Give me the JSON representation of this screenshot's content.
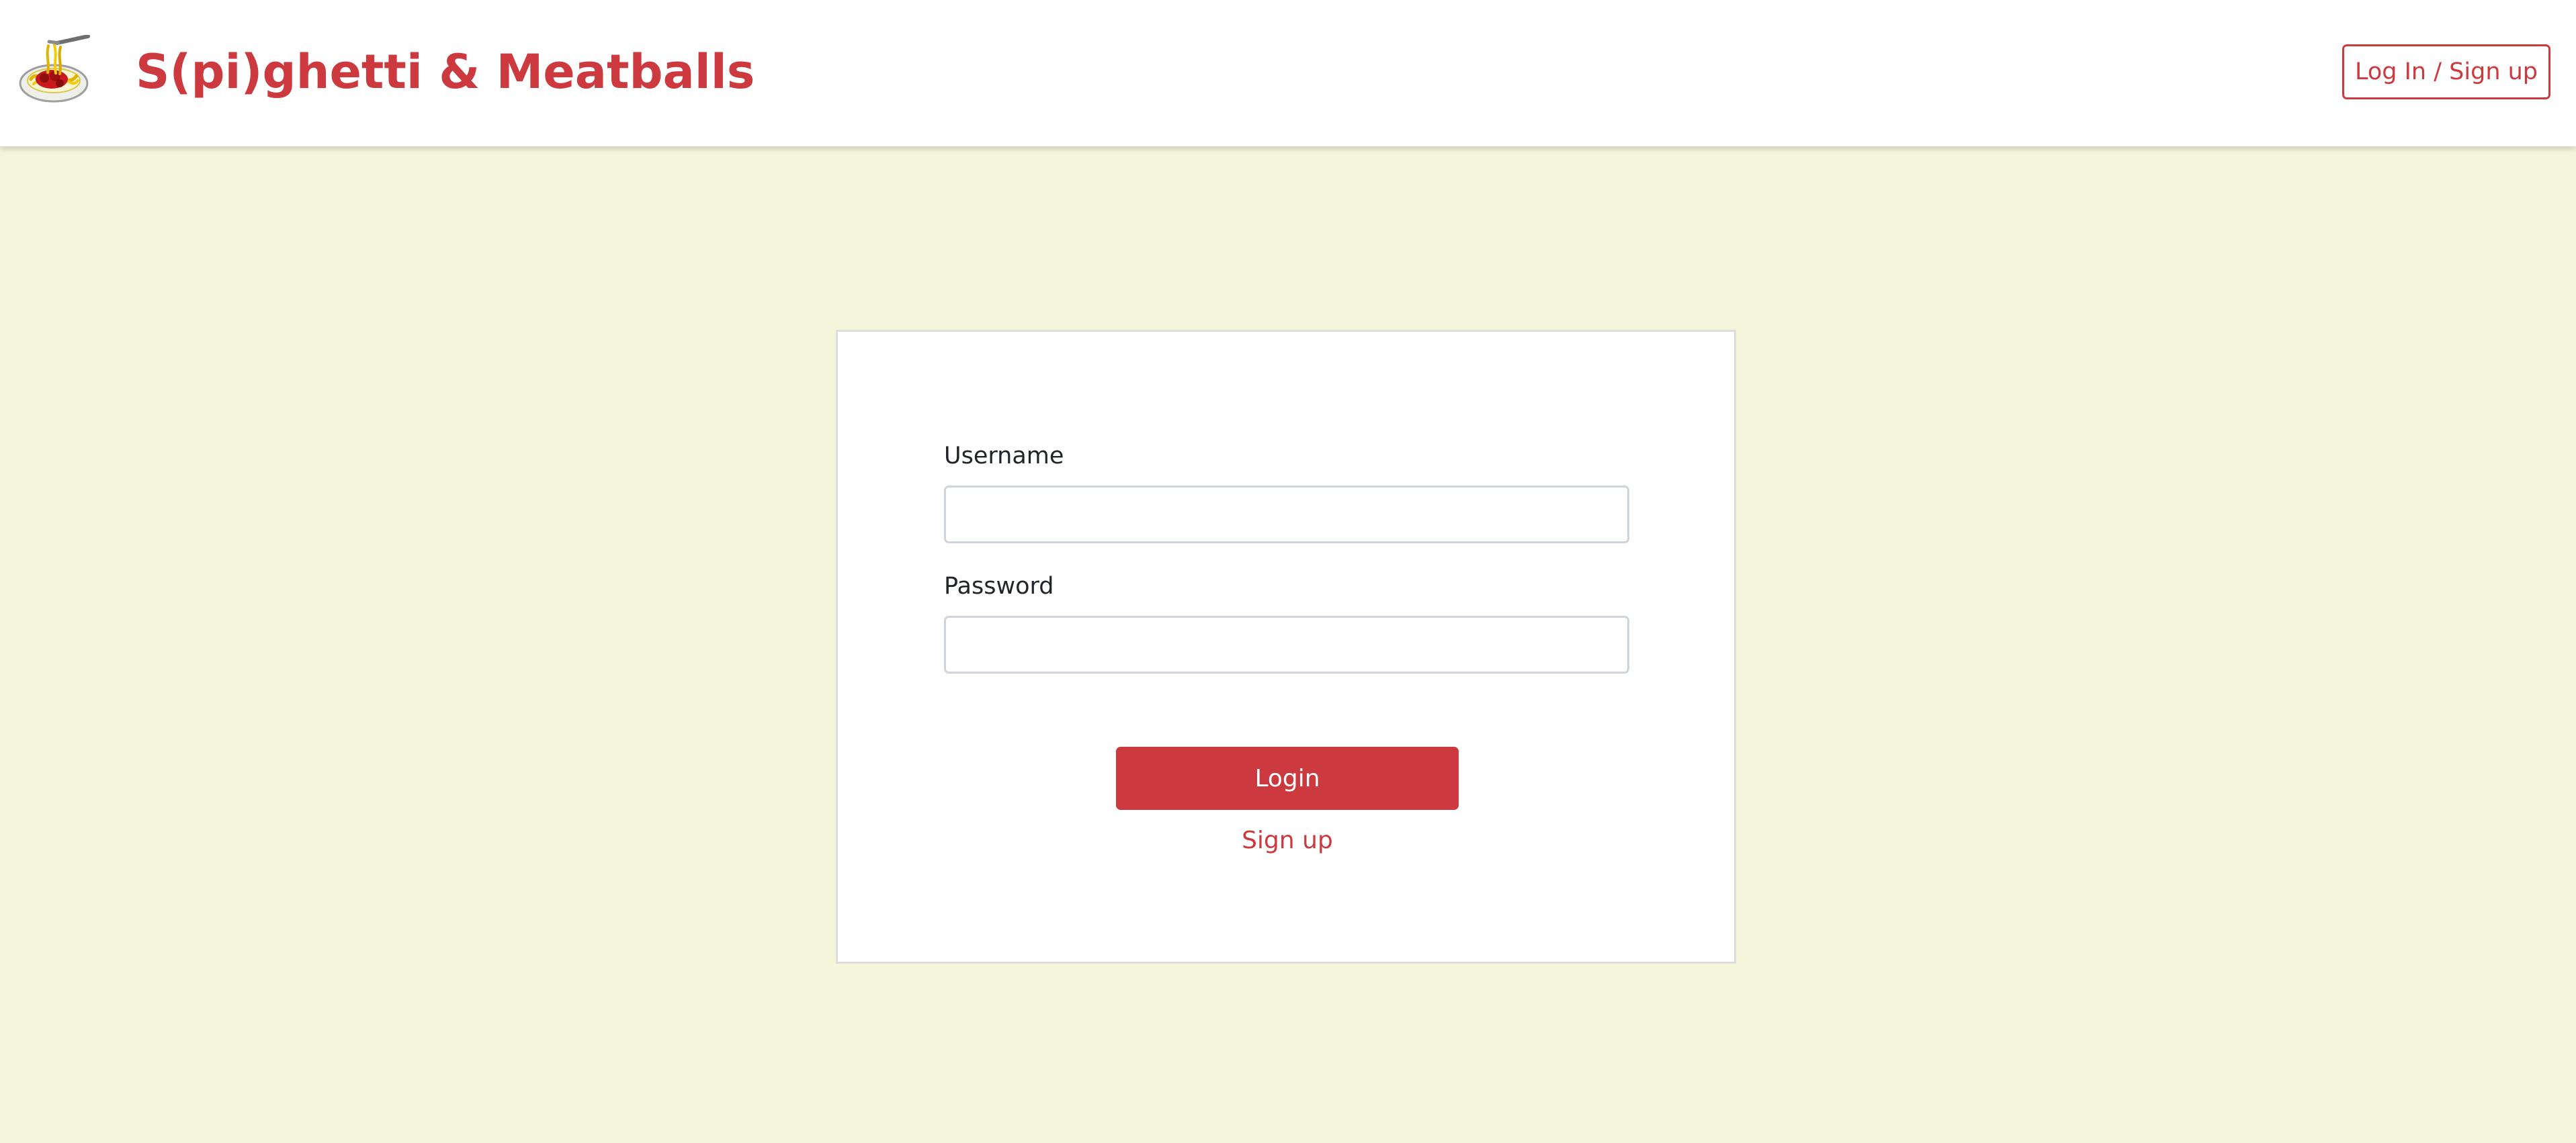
{
  "header": {
    "brand_title": "S(pi)ghetti & Meatballs",
    "logo_icon": "spaghetti-plate-icon",
    "auth_button_label": "Log In / Sign up"
  },
  "login_form": {
    "username_label": "Username",
    "username_value": "",
    "password_label": "Password",
    "password_value": "",
    "login_button_label": "Login",
    "signup_link_label": "Sign up"
  },
  "colors": {
    "brand_red": "#cc3a3f",
    "page_background": "#f5f5dc",
    "header_background": "#ffffff",
    "card_background": "#ffffff",
    "input_border": "#ced4da",
    "text": "#212529"
  }
}
